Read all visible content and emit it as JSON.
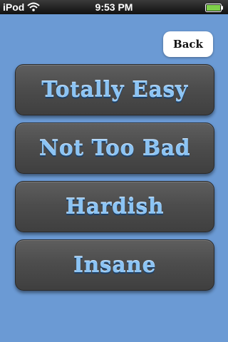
{
  "status_bar": {
    "carrier": "iPod",
    "time": "9:53 PM",
    "icons": [
      "wifi-icon",
      "battery-icon"
    ]
  },
  "nav": {
    "back_label": "Back"
  },
  "difficulty_buttons": [
    {
      "label": "Totally Easy"
    },
    {
      "label": "Not Too Bad"
    },
    {
      "label": "Hardish"
    },
    {
      "label": "Insane"
    }
  ],
  "colors": {
    "background": "#6b9ad4",
    "button_fill": "#4d4d4d",
    "label_text": "#8cc4f4"
  }
}
